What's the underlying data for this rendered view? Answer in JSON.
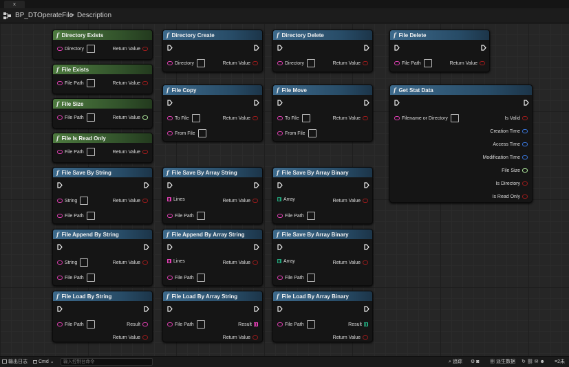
{
  "window": {
    "close_label": "×"
  },
  "breadcrumb": {
    "blueprint": "BP_DTOperateFile",
    "separator": ">",
    "section": "Description"
  },
  "colors": {
    "pure_header": "#4d7a3f",
    "exec_header": "#3d6a8c",
    "string_pin": "#e23fb4",
    "bool_pin": "#9e1b1b",
    "int64_pin": "#b9f5a5",
    "datetime_pin": "#3a78e0",
    "byte_pin": "#22a37a"
  },
  "nodes": [
    {
      "title": "Directory Exists",
      "kind": "pure",
      "inputs": [
        {
          "label": "Directory",
          "type": "string",
          "checkbox": true
        }
      ],
      "outputs": [
        {
          "label": "Return Value",
          "type": "bool"
        }
      ]
    },
    {
      "title": "File Exists",
      "kind": "pure",
      "inputs": [
        {
          "label": "File Path",
          "type": "string",
          "checkbox": true
        }
      ],
      "outputs": [
        {
          "label": "Return Value",
          "type": "bool"
        }
      ]
    },
    {
      "title": "File Size",
      "kind": "pure",
      "inputs": [
        {
          "label": "File Path",
          "type": "string",
          "checkbox": true
        }
      ],
      "outputs": [
        {
          "label": "Return Value",
          "type": "int64"
        }
      ]
    },
    {
      "title": "File Is Read Only",
      "kind": "pure",
      "inputs": [
        {
          "label": "File Path",
          "type": "string",
          "checkbox": true
        }
      ],
      "outputs": [
        {
          "label": "Return Value",
          "type": "bool"
        }
      ]
    },
    {
      "title": "File Save By String",
      "kind": "exec",
      "inputs": [
        {
          "label": "String",
          "type": "string",
          "checkbox": true
        },
        {
          "label": "File Path",
          "type": "string",
          "checkbox": true
        }
      ],
      "outputs": [
        {
          "label": "Return Value",
          "type": "bool"
        }
      ]
    },
    {
      "title": "File Append By String",
      "kind": "exec",
      "inputs": [
        {
          "label": "String",
          "type": "string",
          "checkbox": true
        },
        {
          "label": "File Path",
          "type": "string",
          "checkbox": true
        }
      ],
      "outputs": [
        {
          "label": "Return Value",
          "type": "bool"
        }
      ]
    },
    {
      "title": "File Load By String",
      "kind": "exec",
      "inputs": [
        {
          "label": "File Path",
          "type": "string",
          "checkbox": true
        }
      ],
      "outputs": [
        {
          "label": "Result",
          "type": "string"
        },
        {
          "label": "Return Value",
          "type": "bool"
        }
      ]
    },
    {
      "title": "Directory Create",
      "kind": "exec",
      "inputs": [
        {
          "label": "Directory",
          "type": "string",
          "checkbox": true
        }
      ],
      "outputs": [
        {
          "label": "Return Value",
          "type": "bool"
        }
      ]
    },
    {
      "title": "File Copy",
      "kind": "exec",
      "inputs": [
        {
          "label": "To File",
          "type": "string",
          "checkbox": true
        },
        {
          "label": "From File",
          "type": "string",
          "checkbox": true
        }
      ],
      "outputs": [
        {
          "label": "Return Value",
          "type": "bool"
        }
      ]
    },
    {
      "title": "File Save By Array String",
      "kind": "exec",
      "inputs": [
        {
          "label": "Lines",
          "type": "string-array",
          "checkbox": false
        },
        {
          "label": "File Path",
          "type": "string",
          "checkbox": true
        }
      ],
      "outputs": [
        {
          "label": "Return Value",
          "type": "bool"
        }
      ]
    },
    {
      "title": "File Append By Array String",
      "kind": "exec",
      "inputs": [
        {
          "label": "Lines",
          "type": "string-array",
          "checkbox": false
        },
        {
          "label": "File Path",
          "type": "string",
          "checkbox": true
        }
      ],
      "outputs": [
        {
          "label": "Return Value",
          "type": "bool"
        }
      ]
    },
    {
      "title": "File Load By Array String",
      "kind": "exec",
      "inputs": [
        {
          "label": "File Path",
          "type": "string",
          "checkbox": true
        }
      ],
      "outputs": [
        {
          "label": "Result",
          "type": "string-array"
        },
        {
          "label": "Return Value",
          "type": "bool"
        }
      ]
    },
    {
      "title": "Directory Delete",
      "kind": "exec",
      "inputs": [
        {
          "label": "Directory",
          "type": "string",
          "checkbox": true
        }
      ],
      "outputs": [
        {
          "label": "Return Value",
          "type": "bool"
        }
      ]
    },
    {
      "title": "File Move",
      "kind": "exec",
      "inputs": [
        {
          "label": "To File",
          "type": "string",
          "checkbox": true
        },
        {
          "label": "From File",
          "type": "string",
          "checkbox": true
        }
      ],
      "outputs": [
        {
          "label": "Return Value",
          "type": "bool"
        }
      ]
    },
    {
      "title": "File Save By Array Binary",
      "kind": "exec",
      "inputs": [
        {
          "label": "Array",
          "type": "byte-array",
          "checkbox": false
        },
        {
          "label": "File Path",
          "type": "string",
          "checkbox": true
        }
      ],
      "outputs": [
        {
          "label": "Return Value",
          "type": "bool"
        }
      ]
    },
    {
      "title": "File Save By Array Binary",
      "kind": "exec",
      "inputs": [
        {
          "label": "Array",
          "type": "byte-array",
          "checkbox": false
        },
        {
          "label": "File Path",
          "type": "string",
          "checkbox": true
        }
      ],
      "outputs": [
        {
          "label": "Return Value",
          "type": "bool"
        }
      ]
    },
    {
      "title": "File Load By Array Binary",
      "kind": "exec",
      "inputs": [
        {
          "label": "File Path",
          "type": "string",
          "checkbox": true
        }
      ],
      "outputs": [
        {
          "label": "Result",
          "type": "byte-array"
        },
        {
          "label": "Return Value",
          "type": "bool"
        }
      ]
    },
    {
      "title": "File Delete",
      "kind": "exec",
      "inputs": [
        {
          "label": "File Path",
          "type": "string",
          "checkbox": true
        }
      ],
      "outputs": [
        {
          "label": "Return Value",
          "type": "bool"
        }
      ]
    },
    {
      "title": "Get Stat Data",
      "kind": "exec",
      "inputs": [
        {
          "label": "Filename or Directory",
          "type": "string",
          "checkbox": true
        }
      ],
      "outputs": [
        {
          "label": "Is Valid",
          "type": "bool"
        },
        {
          "label": "Creation Time",
          "type": "datetime"
        },
        {
          "label": "Access Time",
          "type": "datetime"
        },
        {
          "label": "Modification Time",
          "type": "datetime"
        },
        {
          "label": "File Size",
          "type": "int64"
        },
        {
          "label": "Is Directory",
          "type": "bool"
        },
        {
          "label": "Is Read Only",
          "type": "bool"
        }
      ]
    }
  ],
  "statusbar": {
    "output_log": "输出日志",
    "cmd_label": "Cmd",
    "cmd_placeholder": "输入控制台命令",
    "trace_label": "追踪",
    "derived_data_label": "派生数据",
    "source_control_label": "2未"
  }
}
